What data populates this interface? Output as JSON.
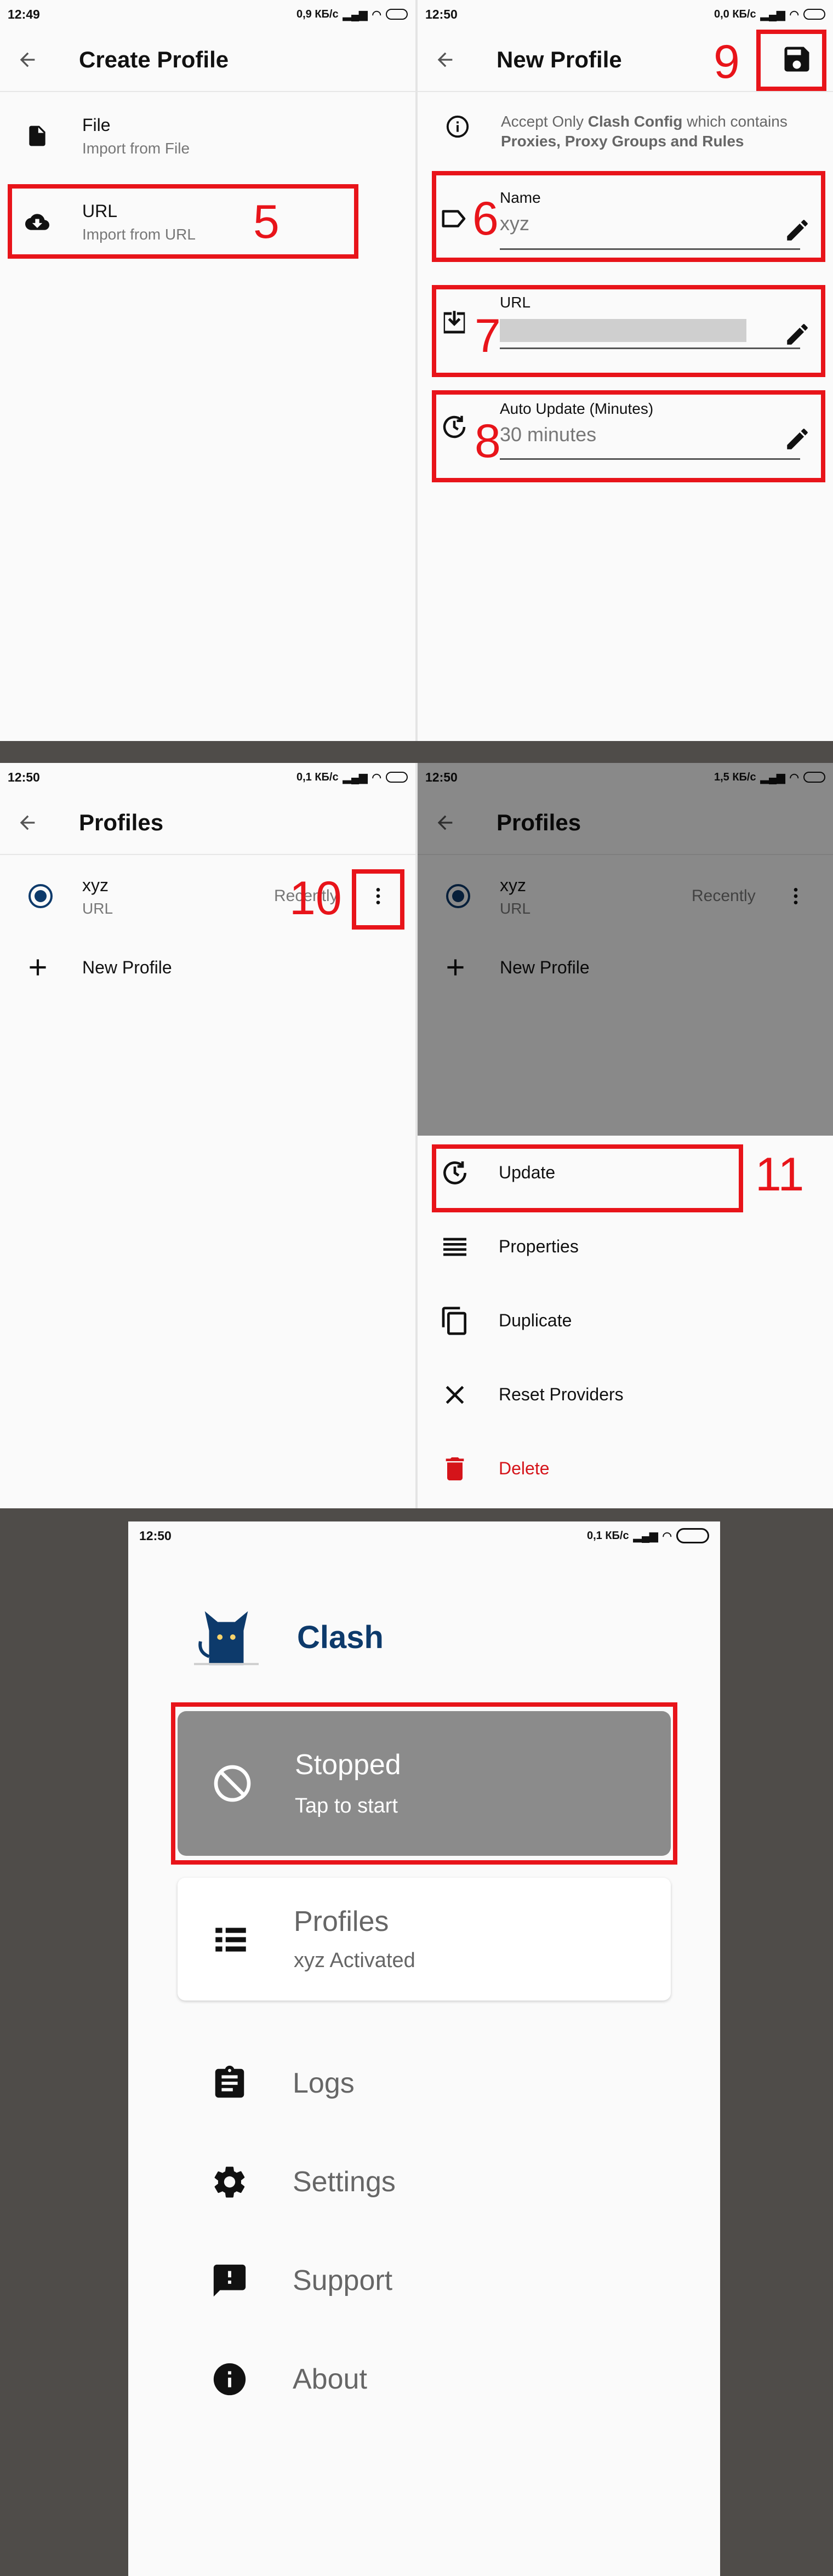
{
  "colors": {
    "annotation": "#e8141a",
    "stopped_card": "#8b8b8b",
    "brand": "#0d3a6b",
    "delete": "#d5141a",
    "radio": "#0d3a6b"
  },
  "panel1": {
    "time": "12:49",
    "net": "0,9 КБ/с",
    "title": "Create Profile",
    "items": [
      {
        "label": "File",
        "sub": "Import from File",
        "icon": "file-icon"
      },
      {
        "label": "URL",
        "sub": "Import from URL",
        "icon": "cloud-download-icon"
      }
    ],
    "annotation": "5"
  },
  "panel2": {
    "time": "12:50",
    "net": "0,0 КБ/с",
    "title": "New Profile",
    "info_prefix": "Accept Only ",
    "info_bold1": "Clash Config",
    "info_mid": " which contains",
    "info_line2": "Proxies, Proxy Groups and Rules",
    "name_label": "Name",
    "name_value": "xyz",
    "url_label": "URL",
    "auto_label": "Auto Update (Minutes)",
    "auto_value": "30 minutes",
    "annotations": [
      "6",
      "7",
      "8",
      "9"
    ]
  },
  "panel3": {
    "time": "12:50",
    "net": "0,1 КБ/с",
    "title": "Profiles",
    "profile_name": "xyz",
    "profile_type": "URL",
    "profile_time": "Recently",
    "new_profile": "New Profile",
    "annotation": "10"
  },
  "panel4": {
    "time": "12:50",
    "net": "1,5 КБ/с",
    "title": "Profiles",
    "profile_name": "xyz",
    "profile_type": "URL",
    "profile_time": "Recently",
    "new_profile": "New Profile",
    "menu": [
      "Update",
      "Properties",
      "Duplicate",
      "Reset Providers",
      "Delete"
    ],
    "annotation": "11"
  },
  "panel5": {
    "time": "12:50",
    "net": "0,1 КБ/с",
    "app_name": "Clash",
    "status_title": "Stopped",
    "status_sub": "Tap to start",
    "profiles_title": "Profiles",
    "profiles_sub": "xyz Activated",
    "nav": [
      "Logs",
      "Settings",
      "Support",
      "About"
    ]
  }
}
